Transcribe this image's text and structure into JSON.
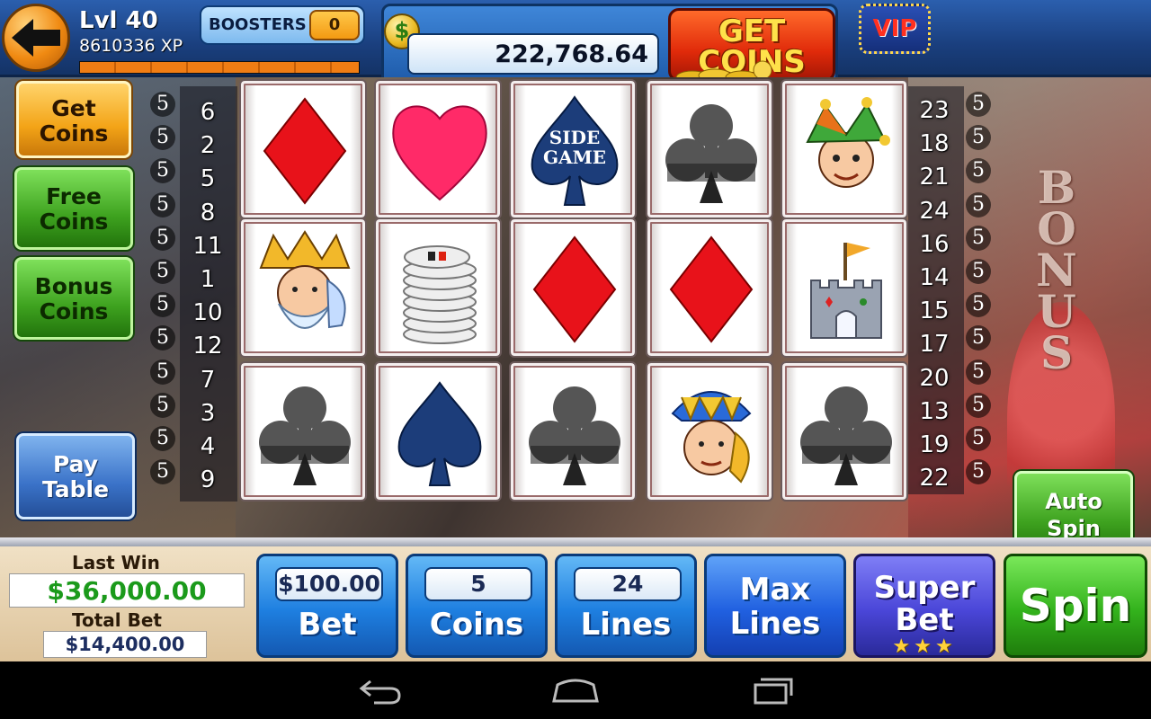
{
  "player": {
    "level": "Lvl 40",
    "xp": "8610336 XP",
    "xp_progress": 1.0
  },
  "boosters": {
    "label": "BOOSTERS",
    "count": "0"
  },
  "coins": {
    "symbol": "$",
    "balance": "222,768.64"
  },
  "get_coins_top": {
    "line1": "GET",
    "line2": "COINS"
  },
  "vip": "VIP",
  "side_buttons": {
    "get_coins": [
      "Get",
      "Coins"
    ],
    "free_coins": [
      "Free",
      "Coins"
    ],
    "bonus_coins": [
      "Bonus",
      "Coins"
    ],
    "pay_table": [
      "Pay",
      "Table"
    ]
  },
  "left_bets": [
    "5",
    "5",
    "5",
    "5",
    "5",
    "5",
    "5",
    "5",
    "5",
    "5",
    "5",
    "5"
  ],
  "left_lines": [
    "6",
    "2",
    "5",
    "8",
    "11",
    "1",
    "10",
    "12",
    "7",
    "3",
    "4",
    "9"
  ],
  "right_lines": [
    "23",
    "18",
    "21",
    "24",
    "16",
    "14",
    "15",
    "17",
    "20",
    "13",
    "19",
    "22"
  ],
  "right_bets": [
    "5",
    "5",
    "5",
    "5",
    "5",
    "5",
    "5",
    "5",
    "5",
    "5",
    "5",
    "5"
  ],
  "bonus_letters": [
    "B",
    "O",
    "N",
    "U",
    "S"
  ],
  "reels": [
    [
      "diamond",
      "heart",
      "side-game-spade",
      "club",
      "jester"
    ],
    [
      "king",
      "poker-chips",
      "diamond",
      "diamond",
      "castle"
    ],
    [
      "club",
      "spade",
      "club",
      "jack",
      "club"
    ]
  ],
  "side_game_text": [
    "SIDE",
    "GAME"
  ],
  "auto_spin": [
    "Auto",
    "Spin"
  ],
  "last_win": {
    "label": "Last Win",
    "value": "$36,000.00"
  },
  "total_bet": {
    "label": "Total Bet",
    "value": "$14,400.00"
  },
  "controls": {
    "bet": {
      "value": "$100.00",
      "label": "Bet"
    },
    "coins": {
      "value": "5",
      "label": "Coins"
    },
    "lines": {
      "value": "24",
      "label": "Lines"
    },
    "max_lines": [
      "Max",
      "Lines"
    ],
    "super_bet": [
      "Super",
      "Bet"
    ],
    "super_bet_stars": "★★★",
    "spin": "Spin"
  },
  "navbar": [
    "back-icon",
    "home-icon",
    "recent-apps-icon"
  ]
}
